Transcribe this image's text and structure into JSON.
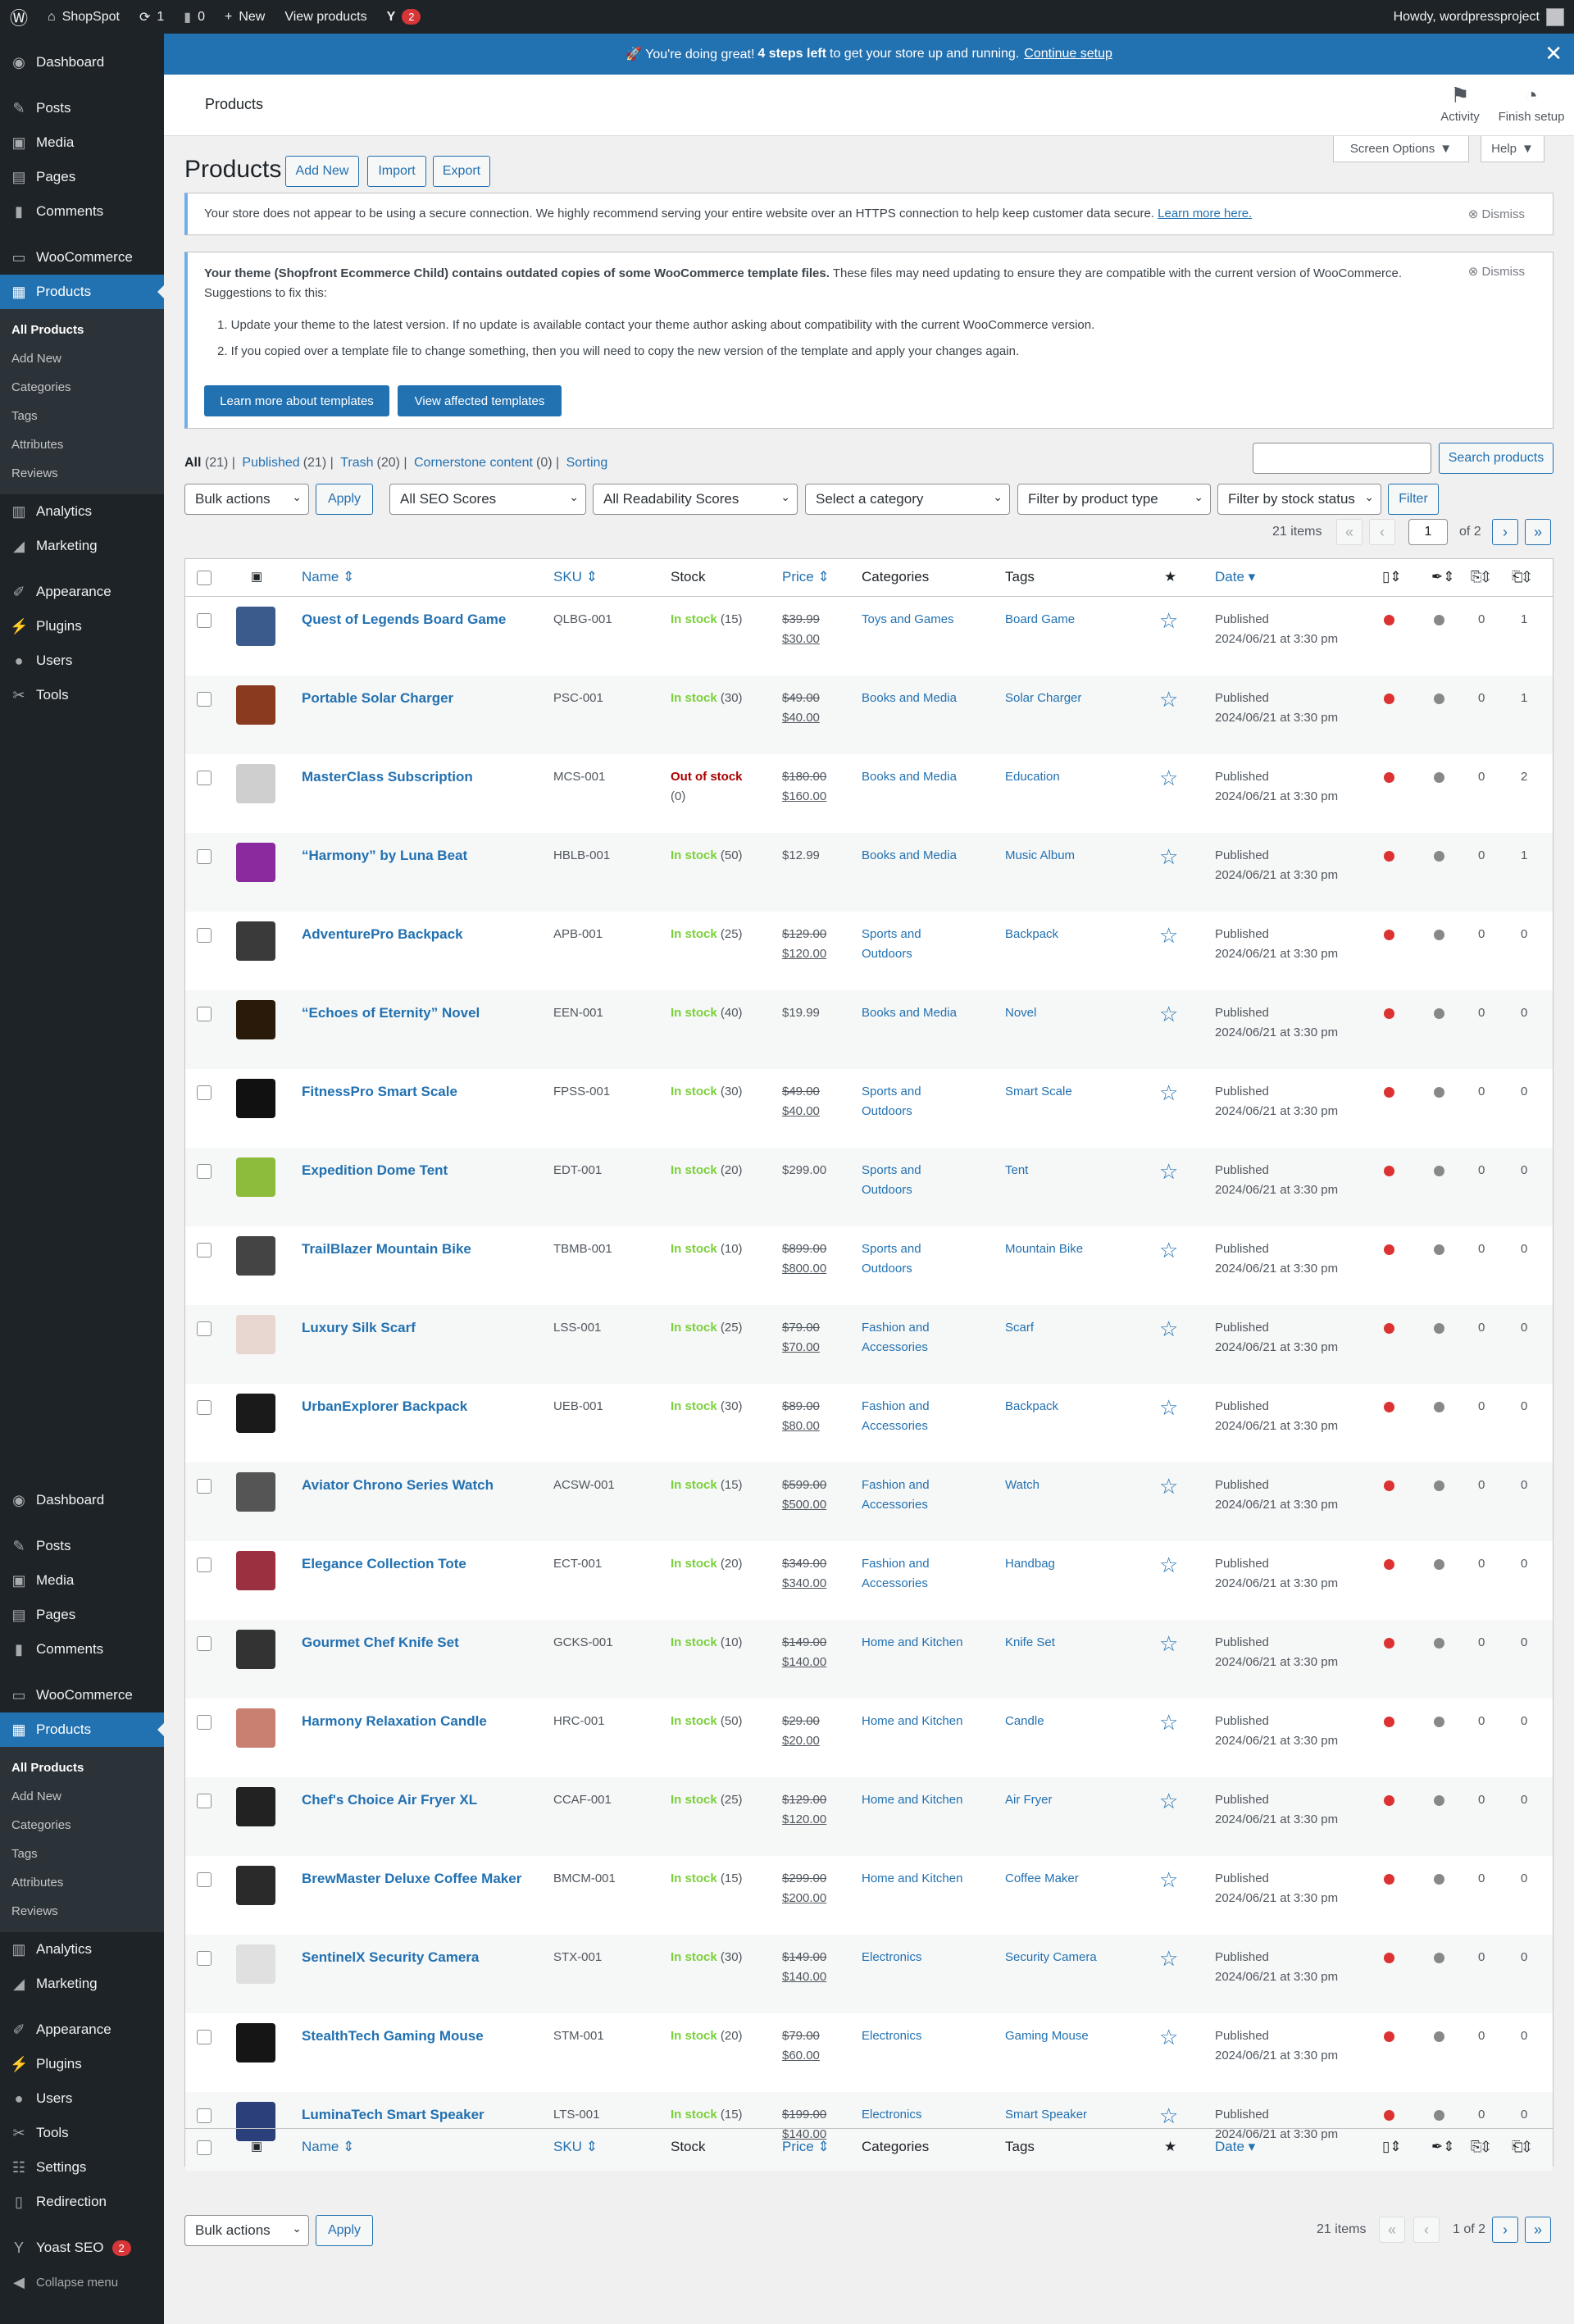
{
  "adminbar": {
    "site": "ShopSpot",
    "updates": "1",
    "comments": "0",
    "new": "New",
    "view": "View products",
    "yoast_count": "2",
    "howdy": "Howdy, wordpressproject"
  },
  "menu": {
    "dashboard": "Dashboard",
    "posts": "Posts",
    "media": "Media",
    "pages": "Pages",
    "comments": "Comments",
    "woocommerce": "WooCommerce",
    "products": "Products",
    "sub": [
      "All Products",
      "Add New",
      "Categories",
      "Tags",
      "Attributes",
      "Reviews"
    ],
    "analytics": "Analytics",
    "marketing": "Marketing",
    "appearance": "Appearance",
    "plugins": "Plugins",
    "users": "Users",
    "tools": "Tools",
    "settings": "Settings",
    "redirection": "Redirection",
    "yoast": "Yoast SEO",
    "yoast_count": "2",
    "collapse": "Collapse menu"
  },
  "banner": {
    "pre": "🚀 You're doing great!",
    "bold": "4 steps left",
    "post": "to get your store up and running.",
    "link": "Continue setup"
  },
  "header": {
    "title": "Products",
    "activity": "Activity",
    "finish": "Finish setup",
    "screen_options": "Screen Options",
    "help": "Help"
  },
  "page": {
    "title": "Products",
    "add_new": "Add New",
    "import": "Import",
    "export": "Export"
  },
  "notice1": {
    "text": "Your store does not appear to be using a secure connection. We highly recommend serving your entire website over an HTTPS connection to help keep customer data secure.",
    "link": "Learn more here.",
    "dismiss": "Dismiss"
  },
  "notice2": {
    "bold": "Your theme (Shopfront Ecommerce Child) contains outdated copies of some WooCommerce template files.",
    "text": "These files may need updating to ensure they are compatible with the current version of WooCommerce. Suggestions to fix this:",
    "step1": "1. Update your theme to the latest version. If no update is available contact your theme author asking about compatibility with the current WooCommerce version.",
    "step2": "2. If you copied over a template file to change something, then you will need to copy the new version of the template and apply your changes again.",
    "btn1": "Learn more about templates",
    "btn2": "View affected templates",
    "dismiss": "Dismiss"
  },
  "views": {
    "all": "All",
    "all_count": "(21)",
    "published": "Published",
    "published_count": "(21)",
    "trash": "Trash",
    "trash_count": "(20)",
    "cornerstone": "Cornerstone content",
    "cornerstone_count": "(0)",
    "sorting": "Sorting"
  },
  "filters": {
    "bulk": "Bulk actions",
    "apply": "Apply",
    "seo": "All SEO Scores",
    "readability": "All Readability Scores",
    "category": "Select a category",
    "type": "Filter by product type",
    "stock": "Filter by stock status",
    "filter": "Filter",
    "search": "Search products"
  },
  "pagination": {
    "items": "21 items",
    "current": "1",
    "of": "of 2",
    "first": "«",
    "prev": "‹",
    "next": "›",
    "last": "»",
    "bottom_page": "1 of 2"
  },
  "columns": {
    "name": "Name",
    "sku": "SKU",
    "stock": "Stock",
    "price": "Price",
    "categories": "Categories",
    "tags": "Tags",
    "date": "Date"
  },
  "products": [
    {
      "name": "Quest of Legends Board Game",
      "sku": "QLBG-001",
      "stock": "In stock",
      "qty": "(15)",
      "reg": "$39.99",
      "sale": "$30.00",
      "cat1": "Toys and Games",
      "cat2": "",
      "tag": "Board Game",
      "status": "Published",
      "date": "2024/06/21 at 3:30 pm",
      "n1": "0",
      "n2": "1",
      "color": "#3b5b8c"
    },
    {
      "name": "Portable Solar Charger",
      "sku": "PSC-001",
      "stock": "In stock",
      "qty": "(30)",
      "reg": "$49.00",
      "sale": "$40.00",
      "cat1": "Books and Media",
      "cat2": "",
      "tag": "Solar Charger",
      "status": "Published",
      "date": "2024/06/21 at 3:30 pm",
      "n1": "0",
      "n2": "1",
      "color": "#8a3a1f"
    },
    {
      "name": "MasterClass Subscription",
      "sku": "MCS-001",
      "stock": "Out of stock",
      "qty": "(0)",
      "reg": "$180.00",
      "sale": "$160.00",
      "cat1": "Books and Media",
      "cat2": "",
      "tag": "Education",
      "status": "Published",
      "date": "2024/06/21 at 3:30 pm",
      "n1": "0",
      "n2": "2",
      "color": "#cfcfcf"
    },
    {
      "name": "“Harmony” by Luna Beat",
      "sku": "HBLB-001",
      "stock": "In stock",
      "qty": "(50)",
      "reg": "$12.99",
      "sale": "",
      "cat1": "Books and Media",
      "cat2": "",
      "tag": "Music Album",
      "status": "Published",
      "date": "2024/06/21 at 3:30 pm",
      "n1": "0",
      "n2": "1",
      "color": "#8b2a9e"
    },
    {
      "name": "AdventurePro Backpack",
      "sku": "APB-001",
      "stock": "In stock",
      "qty": "(25)",
      "reg": "$129.00",
      "sale": "$120.00",
      "cat1": "Sports and",
      "cat2": "Outdoors",
      "tag": "Backpack",
      "status": "Published",
      "date": "2024/06/21 at 3:30 pm",
      "n1": "0",
      "n2": "0",
      "color": "#3a3a3a"
    },
    {
      "name": "“Echoes of Eternity” Novel",
      "sku": "EEN-001",
      "stock": "In stock",
      "qty": "(40)",
      "reg": "$19.99",
      "sale": "",
      "cat1": "Books and Media",
      "cat2": "",
      "tag": "Novel",
      "status": "Published",
      "date": "2024/06/21 at 3:30 pm",
      "n1": "0",
      "n2": "0",
      "color": "#2a1a0a"
    },
    {
      "name": "FitnessPro Smart Scale",
      "sku": "FPSS-001",
      "stock": "In stock",
      "qty": "(30)",
      "reg": "$49.00",
      "sale": "$40.00",
      "cat1": "Sports and",
      "cat2": "Outdoors",
      "tag": "Smart Scale",
      "status": "Published",
      "date": "2024/06/21 at 3:30 pm",
      "n1": "0",
      "n2": "0",
      "color": "#111111"
    },
    {
      "name": "Expedition Dome Tent",
      "sku": "EDT-001",
      "stock": "In stock",
      "qty": "(20)",
      "reg": "$299.00",
      "sale": "",
      "cat1": "Sports and",
      "cat2": "Outdoors",
      "tag": "Tent",
      "status": "Published",
      "date": "2024/06/21 at 3:30 pm",
      "n1": "0",
      "n2": "0",
      "color": "#8dbb3c"
    },
    {
      "name": "TrailBlazer Mountain Bike",
      "sku": "TBMB-001",
      "stock": "In stock",
      "qty": "(10)",
      "reg": "$899.00",
      "sale": "$800.00",
      "cat1": "Sports and",
      "cat2": "Outdoors",
      "tag": "Mountain Bike",
      "status": "Published",
      "date": "2024/06/21 at 3:30 pm",
      "n1": "0",
      "n2": "0",
      "color": "#444444"
    },
    {
      "name": "Luxury Silk Scarf",
      "sku": "LSS-001",
      "stock": "In stock",
      "qty": "(25)",
      "reg": "$79.00",
      "sale": "$70.00",
      "cat1": "Fashion and",
      "cat2": "Accessories",
      "tag": "Scarf",
      "status": "Published",
      "date": "2024/06/21 at 3:30 pm",
      "n1": "0",
      "n2": "0",
      "color": "#e8d6d0"
    },
    {
      "name": "UrbanExplorer Backpack",
      "sku": "UEB-001",
      "stock": "In stock",
      "qty": "(30)",
      "reg": "$89.00",
      "sale": "$80.00",
      "cat1": "Fashion and",
      "cat2": "Accessories",
      "tag": "Backpack",
      "status": "Published",
      "date": "2024/06/21 at 3:30 pm",
      "n1": "0",
      "n2": "0",
      "color": "#1a1a1a"
    },
    {
      "name": "Aviator Chrono Series Watch",
      "sku": "ACSW-001",
      "stock": "In stock",
      "qty": "(15)",
      "reg": "$599.00",
      "sale": "$500.00",
      "cat1": "Fashion and",
      "cat2": "Accessories",
      "tag": "Watch",
      "status": "Published",
      "date": "2024/06/21 at 3:30 pm",
      "n1": "0",
      "n2": "0",
      "color": "#555555"
    },
    {
      "name": "Elegance Collection Tote",
      "sku": "ECT-001",
      "stock": "In stock",
      "qty": "(20)",
      "reg": "$349.00",
      "sale": "$340.00",
      "cat1": "Fashion and",
      "cat2": "Accessories",
      "tag": "Handbag",
      "status": "Published",
      "date": "2024/06/21 at 3:30 pm",
      "n1": "0",
      "n2": "0",
      "color": "#9a3040"
    },
    {
      "name": "Gourmet Chef Knife Set",
      "sku": "GCKS-001",
      "stock": "In stock",
      "qty": "(10)",
      "reg": "$149.00",
      "sale": "$140.00",
      "cat1": "Home and Kitchen",
      "cat2": "",
      "tag": "Knife Set",
      "status": "Published",
      "date": "2024/06/21 at 3:30 pm",
      "n1": "0",
      "n2": "0",
      "color": "#333333"
    },
    {
      "name": "Harmony Relaxation Candle",
      "sku": "HRC-001",
      "stock": "In stock",
      "qty": "(50)",
      "reg": "$29.00",
      "sale": "$20.00",
      "cat1": "Home and Kitchen",
      "cat2": "",
      "tag": "Candle",
      "status": "Published",
      "date": "2024/06/21 at 3:30 pm",
      "n1": "0",
      "n2": "0",
      "color": "#c98070"
    },
    {
      "name": "Chef's Choice Air Fryer XL",
      "sku": "CCAF-001",
      "stock": "In stock",
      "qty": "(25)",
      "reg": "$129.00",
      "sale": "$120.00",
      "cat1": "Home and Kitchen",
      "cat2": "",
      "tag": "Air Fryer",
      "status": "Published",
      "date": "2024/06/21 at 3:30 pm",
      "n1": "0",
      "n2": "0",
      "color": "#222222"
    },
    {
      "name": "BrewMaster Deluxe Coffee Maker",
      "sku": "BMCM-001",
      "stock": "In stock",
      "qty": "(15)",
      "reg": "$299.00",
      "sale": "$200.00",
      "cat1": "Home and Kitchen",
      "cat2": "",
      "tag": "Coffee Maker",
      "status": "Published",
      "date": "2024/06/21 at 3:30 pm",
      "n1": "0",
      "n2": "0",
      "color": "#2a2a2a"
    },
    {
      "name": "SentinelX Security Camera",
      "sku": "STX-001",
      "stock": "In stock",
      "qty": "(30)",
      "reg": "$149.00",
      "sale": "$140.00",
      "cat1": "Electronics",
      "cat2": "",
      "tag": "Security Camera",
      "status": "Published",
      "date": "2024/06/21 at 3:30 pm",
      "n1": "0",
      "n2": "0",
      "color": "#e0e0e0"
    },
    {
      "name": "StealthTech Gaming Mouse",
      "sku": "STM-001",
      "stock": "In stock",
      "qty": "(20)",
      "reg": "$79.00",
      "sale": "$60.00",
      "cat1": "Electronics",
      "cat2": "",
      "tag": "Gaming Mouse",
      "status": "Published",
      "date": "2024/06/21 at 3:30 pm",
      "n1": "0",
      "n2": "0",
      "color": "#151515"
    },
    {
      "name": "LuminaTech Smart Speaker",
      "sku": "LTS-001",
      "stock": "In stock",
      "qty": "(15)",
      "reg": "$199.00",
      "sale": "$140.00",
      "cat1": "Electronics",
      "cat2": "",
      "tag": "Smart Speaker",
      "status": "Published",
      "date": "2024/06/21 at 3:30 pm",
      "n1": "0",
      "n2": "0",
      "color": "#2b3f7a"
    }
  ]
}
